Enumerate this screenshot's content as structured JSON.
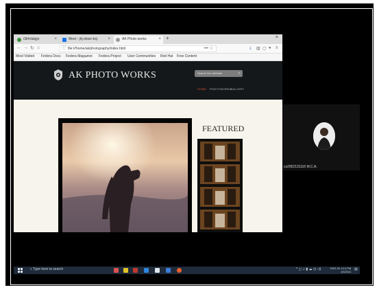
{
  "browser": {
    "tabs": [
      {
        "label": "i3trfrdalgjo",
        "color": "#3b8e3b"
      },
      {
        "label": "Meet - jhj-ekwe-bxj",
        "color": "#1a73e8"
      },
      {
        "label": "AK Photo works",
        "color": "#888888"
      }
    ],
    "new_tab": "+",
    "close": "×",
    "url": "file:///home/ak/photography/index.html",
    "url_dots": "••• ☆",
    "bookmarks": [
      "Most Visited",
      "Fedora Docs",
      "Fedora Magazine",
      "Fedora Project",
      "User Communities",
      "Red Hat",
      "Free Content"
    ]
  },
  "site": {
    "logo_text": "AK PHOTO WORKS",
    "search_placeholder": "Search Our Website",
    "nav": [
      {
        "label": "HOME",
        "active": true
      },
      {
        "label": "PHOTOWORKS",
        "active": false
      },
      {
        "label": "GALLERY",
        "active": false
      }
    ],
    "featured_title": "FEATURED",
    "featured_count": 4
  },
  "participant": {
    "name": "cs2052131116 M.C.A."
  },
  "taskbar": {
    "search_placeholder": "Type here to search",
    "lang": "ENG\nIN",
    "time": "4:14 PM",
    "date": "1/6/2021"
  },
  "colors": {
    "accent_nav": "#e44b3a",
    "header_bg": "#15181a",
    "taskbar_bg": "#1f2b3a"
  }
}
